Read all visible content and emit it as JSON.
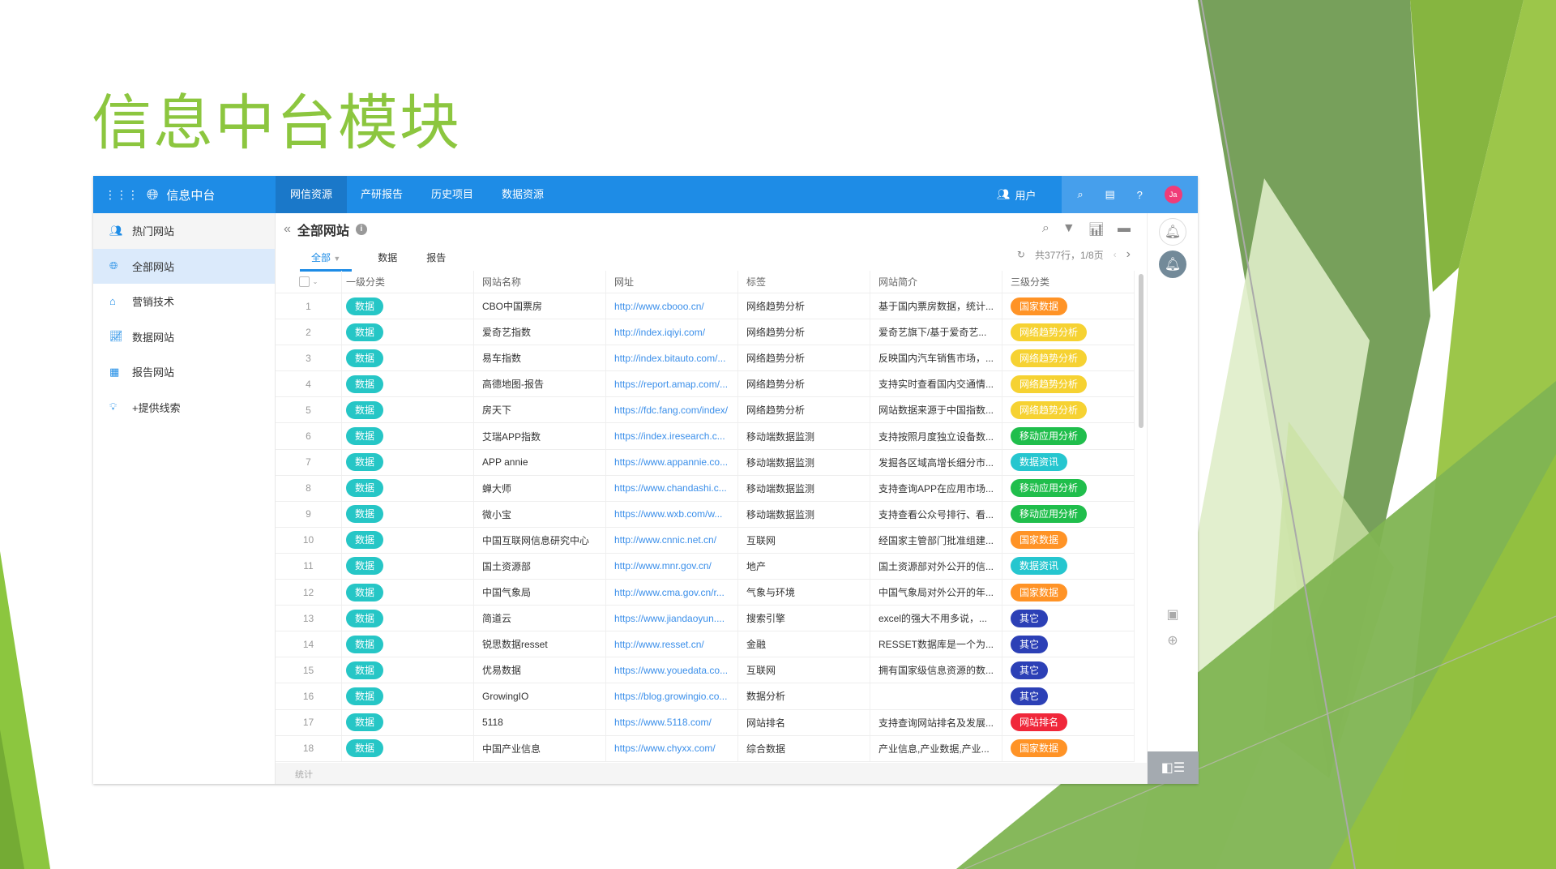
{
  "slide_title": "信息中台模块",
  "colors": {
    "title": "#8cc63f",
    "topbar": "#1e8ce6",
    "tag_primary": "#26c6c6"
  },
  "topbar": {
    "app_name": "信息中台",
    "tabs": [
      "网信资源",
      "产研报告",
      "历史项目",
      "数据资源"
    ],
    "active_tab": 0,
    "users_label": "用户",
    "avatar_initials": "Ja"
  },
  "sidebar": {
    "items": [
      {
        "label": "热门网站",
        "icon": "users-icon"
      },
      {
        "label": "全部网站",
        "icon": "globe-icon"
      },
      {
        "label": "营销技术",
        "icon": "home-icon"
      },
      {
        "label": "数据网站",
        "icon": "chart-icon"
      },
      {
        "label": "报告网站",
        "icon": "report-icon"
      },
      {
        "label": "+提供线索",
        "icon": "lightbulb-icon"
      }
    ],
    "active": 1
  },
  "main": {
    "title": "全部网站",
    "subtabs": [
      "全部",
      "数据",
      "报告"
    ],
    "pager": "共377行，1/8页",
    "footer": "统计"
  },
  "table": {
    "headers": [
      "一级分类",
      "网站名称",
      "网址",
      "标签",
      "网站简介",
      "三级分类"
    ],
    "rows": [
      [
        "1",
        "数据",
        "CBO中国票房",
        "http://www.cbooo.cn/",
        "网络趋势分析",
        "基于国内票房数据，统计...",
        "国家数据"
      ],
      [
        "2",
        "数据",
        "爱奇艺指数",
        "http://index.iqiyi.com/",
        "网络趋势分析",
        "爱奇艺旗下/基于爱奇艺...",
        "网络趋势分析"
      ],
      [
        "3",
        "数据",
        "易车指数",
        "http://index.bitauto.com/...",
        "网络趋势分析",
        "反映国内汽车销售市场，...",
        "网络趋势分析"
      ],
      [
        "4",
        "数据",
        "高德地图-报告",
        "https://report.amap.com/...",
        "网络趋势分析",
        "支持实时查看国内交通情...",
        "网络趋势分析"
      ],
      [
        "5",
        "数据",
        "房天下",
        "https://fdc.fang.com/index/",
        "网络趋势分析",
        "网站数据来源于中国指数...",
        "网络趋势分析"
      ],
      [
        "6",
        "数据",
        "艾瑞APP指数",
        "https://index.iresearch.c...",
        "移动端数据监测",
        "支持按照月度独立设备数...",
        "移动应用分析"
      ],
      [
        "7",
        "数据",
        "APP annie",
        "https://www.appannie.co...",
        "移动端数据监测",
        "发掘各区域高增长细分市...",
        "数据资讯"
      ],
      [
        "8",
        "数据",
        "蝉大师",
        "https://www.chandashi.c...",
        "移动端数据监测",
        "支持查询APP在应用市场...",
        "移动应用分析"
      ],
      [
        "9",
        "数据",
        "微小宝",
        "https://www.wxb.com/w...",
        "移动端数据监测",
        "支持查看公众号排行、看...",
        "移动应用分析"
      ],
      [
        "10",
        "数据",
        "中国互联网信息研究中心",
        "http://www.cnnic.net.cn/",
        "互联网",
        "经国家主管部门批准组建...",
        "国家数据"
      ],
      [
        "11",
        "数据",
        "国土资源部",
        "http://www.mnr.gov.cn/",
        "地产",
        "国土资源部对外公开的信...",
        "数据资讯"
      ],
      [
        "12",
        "数据",
        "中国气象局",
        "http://www.cma.gov.cn/r...",
        "气象与环境",
        "中国气象局对外公开的年...",
        "国家数据"
      ],
      [
        "13",
        "数据",
        "简道云",
        "https://www.jiandaoyun....",
        "搜索引擎",
        "excel的强大不用多说，...",
        "其它"
      ],
      [
        "14",
        "数据",
        "锐思数据resset",
        "http://www.resset.cn/",
        "金融",
        "RESSET数据库是一个为...",
        "其它"
      ],
      [
        "15",
        "数据",
        "优易数据",
        "https://www.youedata.co...",
        "互联网",
        "拥有国家级信息资源的数...",
        "其它"
      ],
      [
        "16",
        "数据",
        "GrowingIO",
        "https://blog.growingio.co...",
        "数据分析",
        "",
        "其它"
      ],
      [
        "17",
        "数据",
        "5118",
        "https://www.5118.com/",
        "网站排名",
        "支持查询网站排名及发展...",
        "网站排名"
      ],
      [
        "18",
        "数据",
        "中国产业信息",
        "https://www.chyxx.com/",
        "综合数据",
        "产业信息,产业数据,产业...",
        "国家数据"
      ]
    ]
  },
  "tag_colors": {
    "国家数据": "#ff9326",
    "网络趋势分析": "#f6d232",
    "移动应用分析": "#20be4c",
    "数据资讯": "#26c6cf",
    "其它": "#2c40b6",
    "网站排名": "#f0273a"
  }
}
